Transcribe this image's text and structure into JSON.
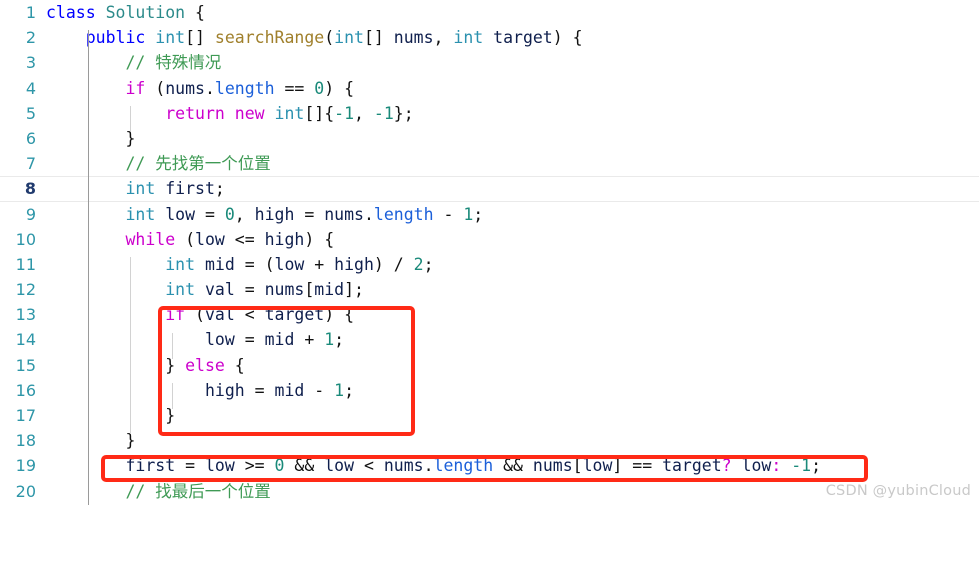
{
  "editor": {
    "language": "java",
    "background_color": "#ffffff",
    "gutter_color": "#2e96a8",
    "current_line": 8,
    "lines": [
      {
        "n": "1",
        "text": "class Solution {"
      },
      {
        "n": "2",
        "text": "    public int[] searchRange(int[] nums, int target) {"
      },
      {
        "n": "3",
        "text": "        // 特殊情况"
      },
      {
        "n": "4",
        "text": "        if (nums.length == 0) {"
      },
      {
        "n": "5",
        "text": "            return new int[]{-1, -1};"
      },
      {
        "n": "6",
        "text": "        }"
      },
      {
        "n": "7",
        "text": "        // 先找第一个位置"
      },
      {
        "n": "8",
        "text": "        int first;"
      },
      {
        "n": "9",
        "text": "        int low = 0, high = nums.length - 1;"
      },
      {
        "n": "10",
        "text": "        while (low <= high) {"
      },
      {
        "n": "11",
        "text": "            int mid = (low + high) / 2;"
      },
      {
        "n": "12",
        "text": "            int val = nums[mid];"
      },
      {
        "n": "13",
        "text": "            if (val < target) {"
      },
      {
        "n": "14",
        "text": "                low = mid + 1;"
      },
      {
        "n": "15",
        "text": "            } else {"
      },
      {
        "n": "16",
        "text": "                high = mid - 1;"
      },
      {
        "n": "17",
        "text": "            }"
      },
      {
        "n": "18",
        "text": "        }"
      },
      {
        "n": "19",
        "text": "        first = low >= 0 && low < nums.length && nums[low] == target? low: -1;"
      },
      {
        "n": "20",
        "text": "        // 找最后一个位置"
      }
    ]
  },
  "annotations": {
    "color": "#ff2a16",
    "boxes": [
      {
        "name": "if-else-block-highlight",
        "covers_lines": "13-17"
      },
      {
        "name": "first-assignment-highlight",
        "covers_lines": "19"
      }
    ]
  },
  "watermark": {
    "text": "CSDN @yubinCloud",
    "color": "#c9c9c9"
  }
}
